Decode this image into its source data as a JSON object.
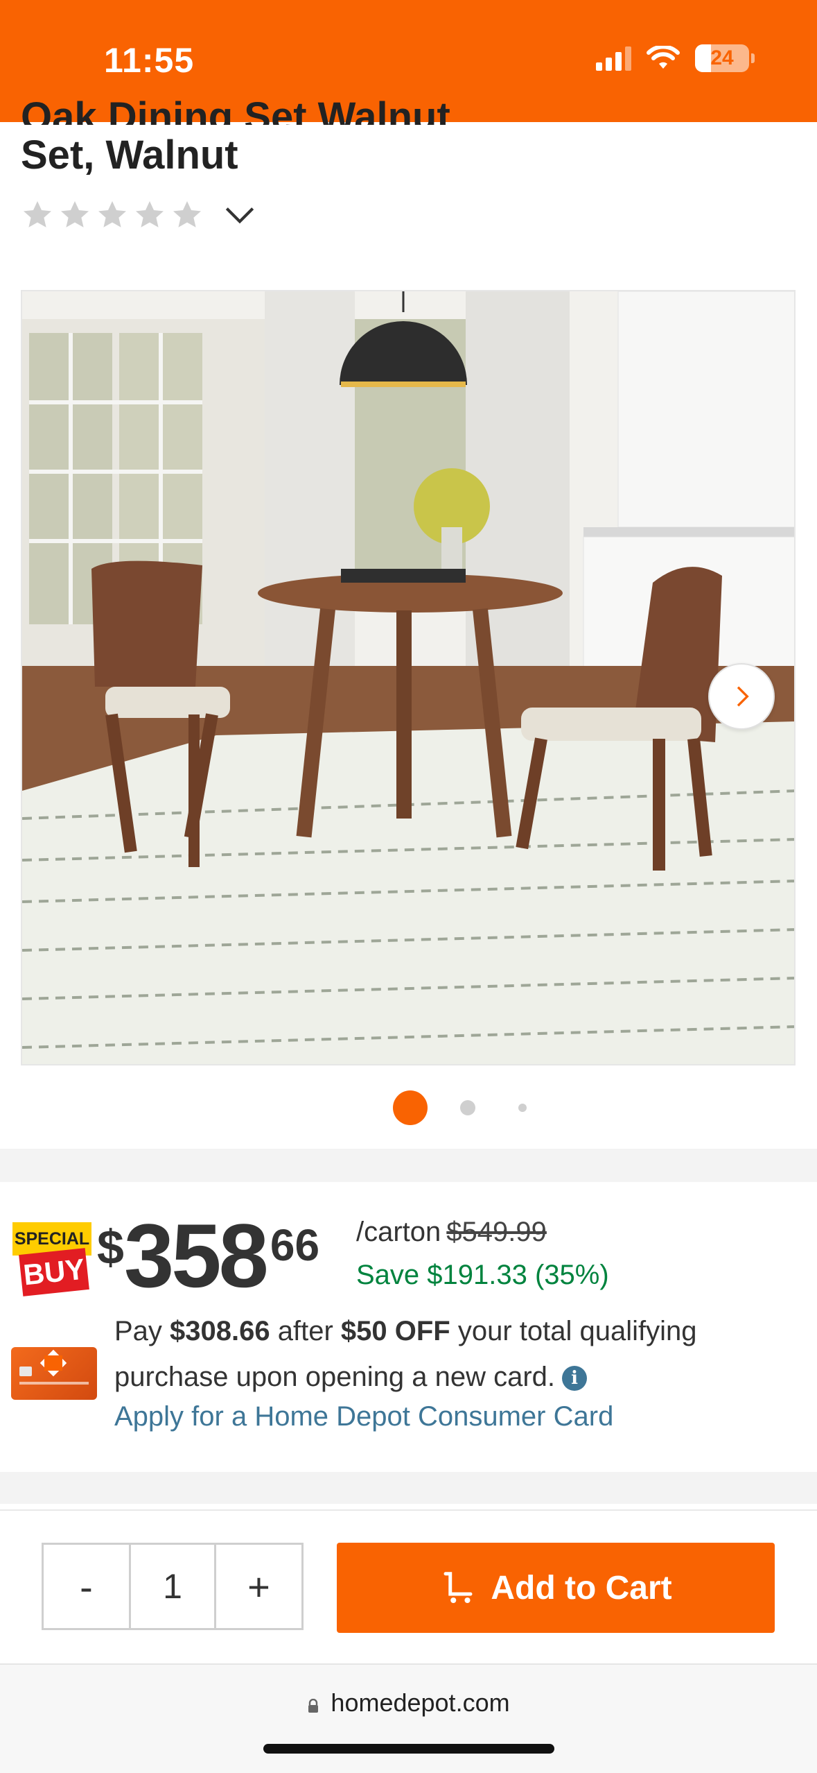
{
  "status_bar": {
    "time": "11:55",
    "battery": "24"
  },
  "product": {
    "title_partial": "Oak Dining Set Walnut",
    "title_line": "Set, Walnut",
    "rating_stars": 0
  },
  "gallery": {
    "dots": 3,
    "active_dot": 1
  },
  "price": {
    "badge_top": "SPECIAL",
    "badge_bottom": "BUY",
    "symbol": "$",
    "dollars": "358",
    "cents": "66",
    "unit": "/carton",
    "was": "$549.99",
    "save": "Save $191.33 (35%)"
  },
  "offer": {
    "t1": "Pay ",
    "b1": "$308.66",
    "t2": " after ",
    "b2": "$50 OFF",
    "t3": " your total qualifying purchase upon opening a new card.",
    "info_icon": "i",
    "apply_link": "Apply for a Home Depot Consumer Card"
  },
  "cart": {
    "minus": "-",
    "quantity": "1",
    "plus": "+",
    "add_label": "Add to Cart"
  },
  "browser": {
    "url": "homedepot.com"
  },
  "colors": {
    "brand_orange": "#f96302",
    "save_green": "#00833e",
    "link_blue": "#3e7697"
  }
}
